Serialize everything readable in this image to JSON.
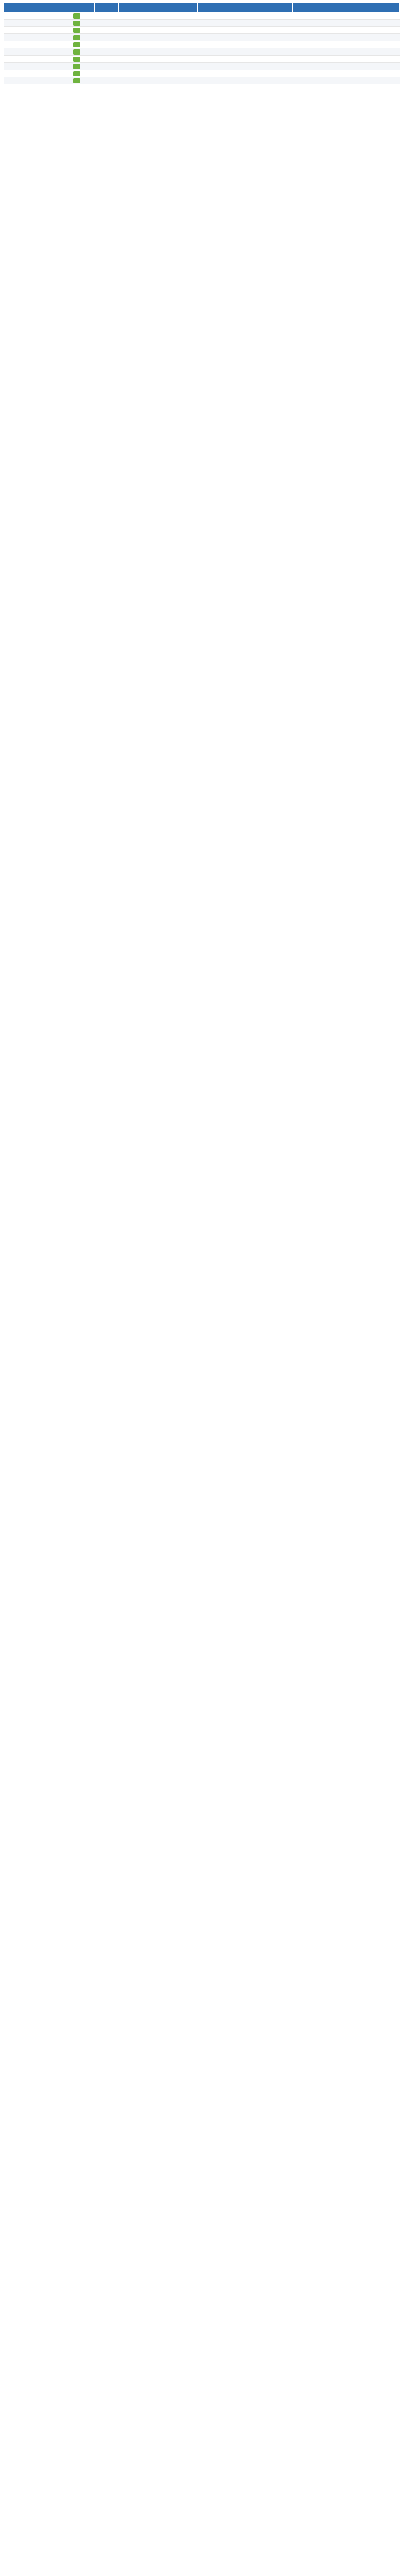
{
  "table": {
    "columns": [
      "",
      "",
      "",
      "",
      "",
      "",
      "",
      "",
      ""
    ],
    "badge_color": "#6fb33f",
    "header_color": "#2f6fb3",
    "rows": [
      [
        "",
        "",
        "",
        "",
        "",
        "",
        "",
        ""
      ],
      [
        "",
        "",
        "",
        "",
        "",
        "",
        "",
        ""
      ],
      [
        "",
        "",
        "",
        "",
        "",
        "",
        "",
        ""
      ],
      [
        "",
        "",
        "",
        "",
        "",
        "",
        "",
        ""
      ],
      [
        "",
        "",
        "",
        "",
        "",
        "",
        "",
        ""
      ],
      [
        "",
        "",
        "",
        "",
        "",
        "",
        "",
        ""
      ],
      [
        "",
        "",
        "",
        "",
        "",
        "",
        "",
        ""
      ],
      [
        "",
        "",
        "",
        "",
        "",
        "",
        "",
        ""
      ],
      [
        "",
        "",
        "",
        "",
        "",
        "",
        "",
        ""
      ],
      [
        "",
        "",
        "",
        "",
        "",
        "",
        "",
        ""
      ]
    ]
  }
}
